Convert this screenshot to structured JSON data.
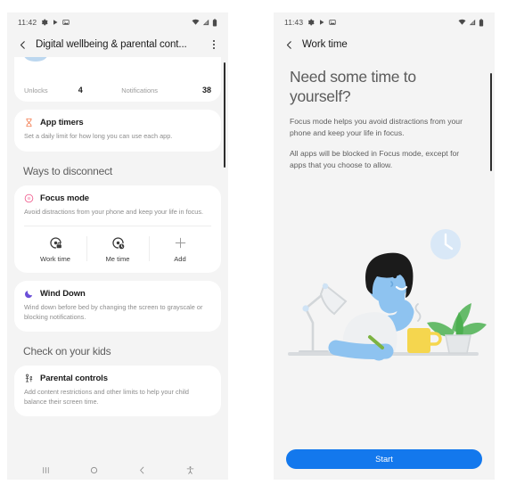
{
  "colors": {
    "screen_bg": "#f4f4f4",
    "card_bg": "#ffffff",
    "accent_blue": "#1378ed",
    "focus_pink": "#f06292",
    "timer_orange": "#f2784b",
    "wind_purple": "#6b4fd8",
    "parental_gray": "#3c3c3c"
  },
  "left_phone": {
    "status_bar": {
      "clock": "11:42",
      "left_icons": [
        "gear-icon",
        "play-icon",
        "image-icon"
      ],
      "right_icons": [
        "wifi-icon",
        "signal-icon",
        "battery-icon"
      ]
    },
    "app_bar": {
      "back_icon": "chevron-left-icon",
      "title": "Digital wellbeing & parental cont...",
      "menu_icon": "overflow-menu-icon"
    },
    "usage_card": {
      "chart_icon": "usage-donut-chart",
      "stats": [
        {
          "label": "Unlocks",
          "value": "4"
        },
        {
          "label": "Notifications",
          "value": "38"
        }
      ]
    },
    "app_timers": {
      "icon": "hourglass-icon",
      "title": "App timers",
      "description": "Set a daily limit for how long you can use each app."
    },
    "section_disconnect": "Ways to disconnect",
    "focus_mode": {
      "icon": "focus-mode-icon",
      "title": "Focus mode",
      "description": "Avoid distractions from your phone and keep your life in focus.",
      "tiles": [
        {
          "icon": "work-time-icon",
          "label": "Work time"
        },
        {
          "icon": "me-time-icon",
          "label": "Me time"
        },
        {
          "icon": "plus-icon",
          "label": "Add"
        }
      ]
    },
    "wind_down": {
      "icon": "moon-icon",
      "title": "Wind Down",
      "description": "Wind down before bed by changing the screen to grayscale or blocking notifications."
    },
    "section_kids": "Check on your kids",
    "parental_controls": {
      "icon": "parental-controls-icon",
      "title": "Parental controls",
      "description": "Add content restrictions and other limits to help your child balance their screen time."
    },
    "nav_bar": {
      "recents_icon": "recents-icon",
      "home_icon": "home-icon",
      "back_icon": "back-icon",
      "accessibility_icon": "accessibility-icon"
    }
  },
  "right_phone": {
    "status_bar": {
      "clock": "11:43",
      "left_icons": [
        "gear-icon",
        "play-icon",
        "image-icon"
      ],
      "right_icons": [
        "wifi-icon",
        "signal-icon",
        "battery-icon"
      ]
    },
    "app_bar": {
      "back_icon": "chevron-left-icon",
      "title": "Work time"
    },
    "headline": "Need some time to yourself?",
    "paragraph_1": "Focus mode helps you avoid distractions from your phone and keep your life in focus.",
    "paragraph_2": "All apps will be blocked in Focus mode, except for apps that you choose to allow.",
    "illustration": "person-at-desk-illustration",
    "start_button": "Start",
    "nav_bar": {
      "recents_icon": "recents-icon",
      "home_icon": "home-icon",
      "back_icon": "back-icon",
      "accessibility_icon": "accessibility-icon"
    }
  }
}
